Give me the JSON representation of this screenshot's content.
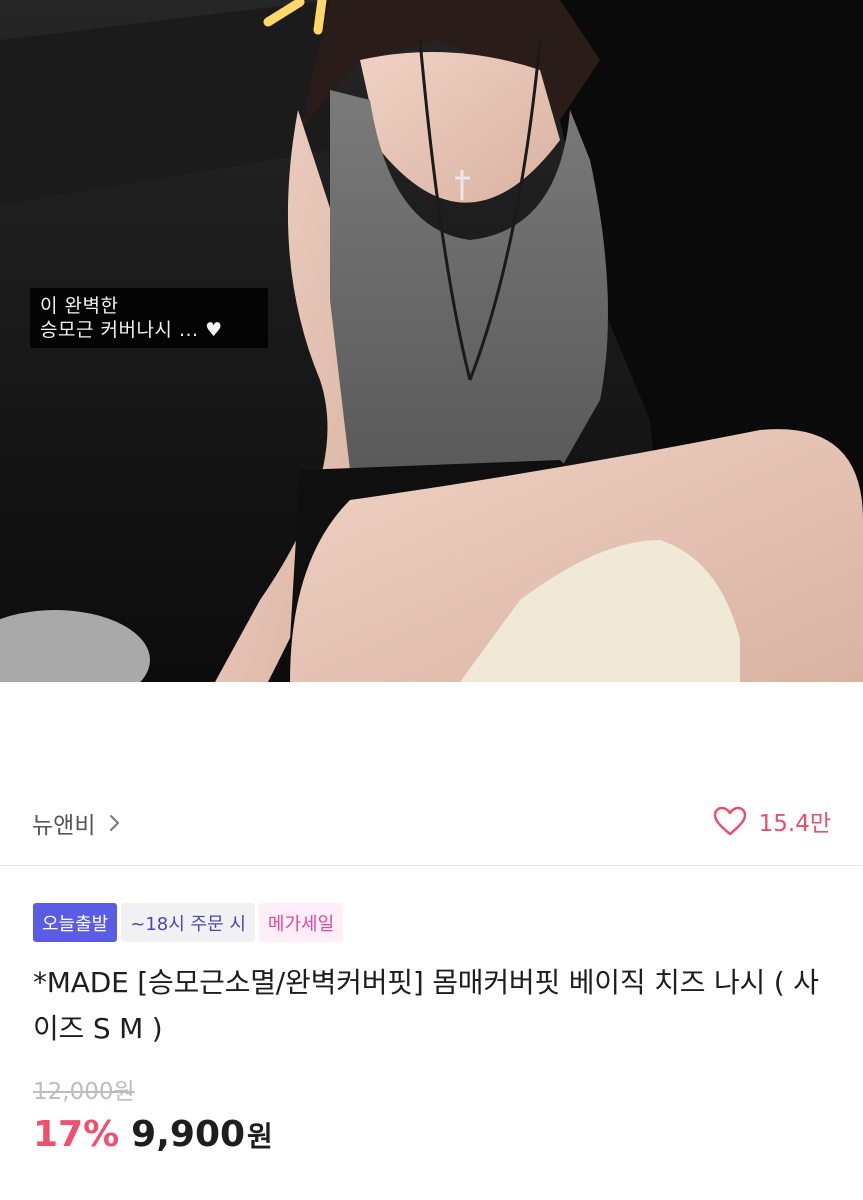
{
  "image": {
    "overlay_caption_line1": "이 완벽한",
    "overlay_caption_line2": "승모근 커버나시 ... ♥"
  },
  "seller": {
    "name": "뉴앤비",
    "chevron_icon": "chevron-right-icon"
  },
  "likes": {
    "icon": "heart-outline-icon",
    "count": "15.4만",
    "color": "#e8506a"
  },
  "badges": [
    {
      "label": "오늘출발",
      "color": "#5b5ce6"
    },
    {
      "label": "~18시 주문 시",
      "color": "#4747b8"
    },
    {
      "label": "메가세일",
      "color": "#e5489a"
    }
  ],
  "product": {
    "title": "*MADE [승모근소멸/완벽커버핏] 몸매커버핏 베이직 치즈 나시 ( 사이즈 S M )",
    "original_price": "12,000원",
    "discount": "17%",
    "price": "9,900",
    "currency": "원",
    "discount_color": "#f0506e"
  }
}
